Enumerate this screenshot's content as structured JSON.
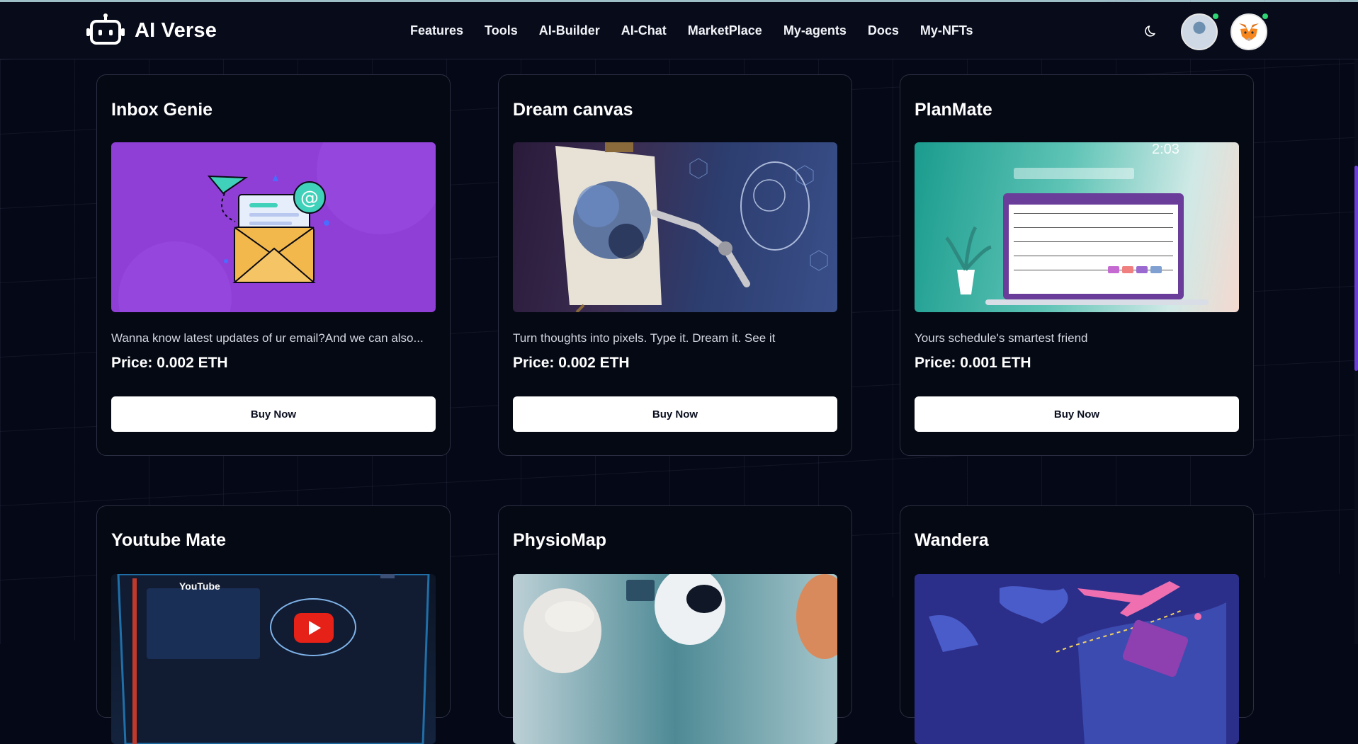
{
  "app": {
    "name": "AI Verse",
    "logo_icon": "robot-icon"
  },
  "nav": {
    "items": [
      "Features",
      "Tools",
      "AI-Builder",
      "AI-Chat",
      "MarketPlace",
      "My-agents",
      "Docs",
      "My-NFTs"
    ]
  },
  "header": {
    "theme_icon": "moon-icon",
    "wallet_icon": "metamask-fox-icon",
    "status_color": "#2ed573"
  },
  "cards": [
    {
      "title": "Inbox Genie",
      "description": "Wanna know latest updates of ur email?And we can also...",
      "price": "Price: 0.002 ETH",
      "button": "Buy Now",
      "image": "email-envelope-illustration"
    },
    {
      "title": "Dream canvas",
      "description": "Turn thoughts into pixels. Type it. Dream it. See it",
      "price": "Price: 0.002 ETH",
      "button": "Buy Now",
      "image": "robot-painting-canvas"
    },
    {
      "title": "PlanMate",
      "description": "Yours schedule's smartest friend",
      "price": "Price: 0.001 ETH",
      "button": "Buy Now",
      "image": "calendar-laptop",
      "image_clock": "2:03"
    },
    {
      "title": "Youtube Mate",
      "image": "youtube-screen",
      "image_text": "YouTube"
    },
    {
      "title": "PhysioMap",
      "image": "robot-doctor-patient"
    },
    {
      "title": "Wandera",
      "image": "travel-map-plane"
    }
  ],
  "theme": {
    "accent": "#6b3fd6",
    "card_border": "#2a2f42",
    "background": "#050816"
  }
}
